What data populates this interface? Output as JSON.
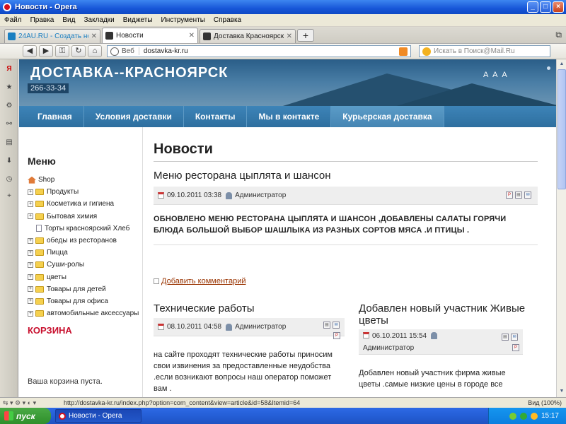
{
  "window": {
    "title": "Новости - Opera"
  },
  "menubar": [
    "Файл",
    "Правка",
    "Вид",
    "Закладки",
    "Виджеты",
    "Инструменты",
    "Справка"
  ],
  "tabs": [
    {
      "label": "24AU.RU - Создать нов...",
      "color": "#1a7fc1"
    },
    {
      "label": "Новости",
      "color": "#222222"
    },
    {
      "label": "Доставка Красноярск -...",
      "color": "#222222"
    }
  ],
  "navbar": {
    "web_label": "Веб",
    "url": "dostavka-kr.ru",
    "search_placeholder": "Искать в Поиск@Mail.Ru"
  },
  "site": {
    "title": "ДОСТАВКА--КРАСНОЯРСК",
    "phone": "266-33-34",
    "font_buttons": "A A A",
    "nav": [
      "Главная",
      "Условия доставки",
      "Контакты",
      "Мы в контакте",
      "Курьерская доставка"
    ]
  },
  "sidebar": {
    "title": "Меню",
    "items": [
      {
        "label": "Shop",
        "kind": "home"
      },
      {
        "label": "Продукты",
        "kind": "folder"
      },
      {
        "label": "Косметика и гигиена",
        "kind": "folder"
      },
      {
        "label": "Бытовая химия",
        "kind": "folder"
      },
      {
        "label": "Торты красноярский Хлеб",
        "kind": "doc"
      },
      {
        "label": "обеды из ресторанов",
        "kind": "folder"
      },
      {
        "label": "Пицца",
        "kind": "folder"
      },
      {
        "label": "Суши-ролы",
        "kind": "folder"
      },
      {
        "label": "цветы",
        "kind": "folder"
      },
      {
        "label": "Товары для детей",
        "kind": "folder"
      },
      {
        "label": "Товары для офиса",
        "kind": "folder"
      },
      {
        "label": "автомобильные аксессуары",
        "kind": "folder"
      }
    ],
    "cart_title": "КОРЗИНА",
    "cart_empty": "Ваша корзина пуста."
  },
  "main": {
    "heading": "Новости",
    "articles": [
      {
        "title": "Меню ресторана цыплята и шансон",
        "date": "09.10.2011 03:38",
        "author": "Администратор",
        "body": "ОБНОВЛЕНО МЕНЮ РЕСТОРАНА ЦЫПЛЯТА И ШАНСОН ,ДОБАВЛЕНЫ САЛАТЫ ГОРЯЧИ БЛЮДА БОЛЬШОЙ ВЫБОР ШАШЛЫКА ИЗ РАЗНЫХ СОРТОВ МЯСА .И ПТИЦЫ .",
        "comment_link": "Добавить комментарий"
      },
      {
        "title": "Технические работы",
        "date": "08.10.2011 04:58",
        "author": "Администратор",
        "body": "на сайте проходят технические работы приносим свои извинения за предоставленные неудобства .если возникают вопросы наш оператор поможет вам ."
      },
      {
        "title": "Добавлен новый участник Живые цветы",
        "date": "06.10.2011 15:54",
        "author": "Администратор",
        "body": "Добавлен новый участник фирма живые цветы .самые низкие цены в городе все"
      }
    ]
  },
  "statusbar": {
    "url": "http://dostavka-kr.ru/index.php?option=com_content&view=article&id=58&Itemid=64",
    "zoom": "Вид (100%)"
  },
  "taskbar": {
    "start": "пуск",
    "task": "Новости - Opera",
    "clock": "15:17"
  }
}
